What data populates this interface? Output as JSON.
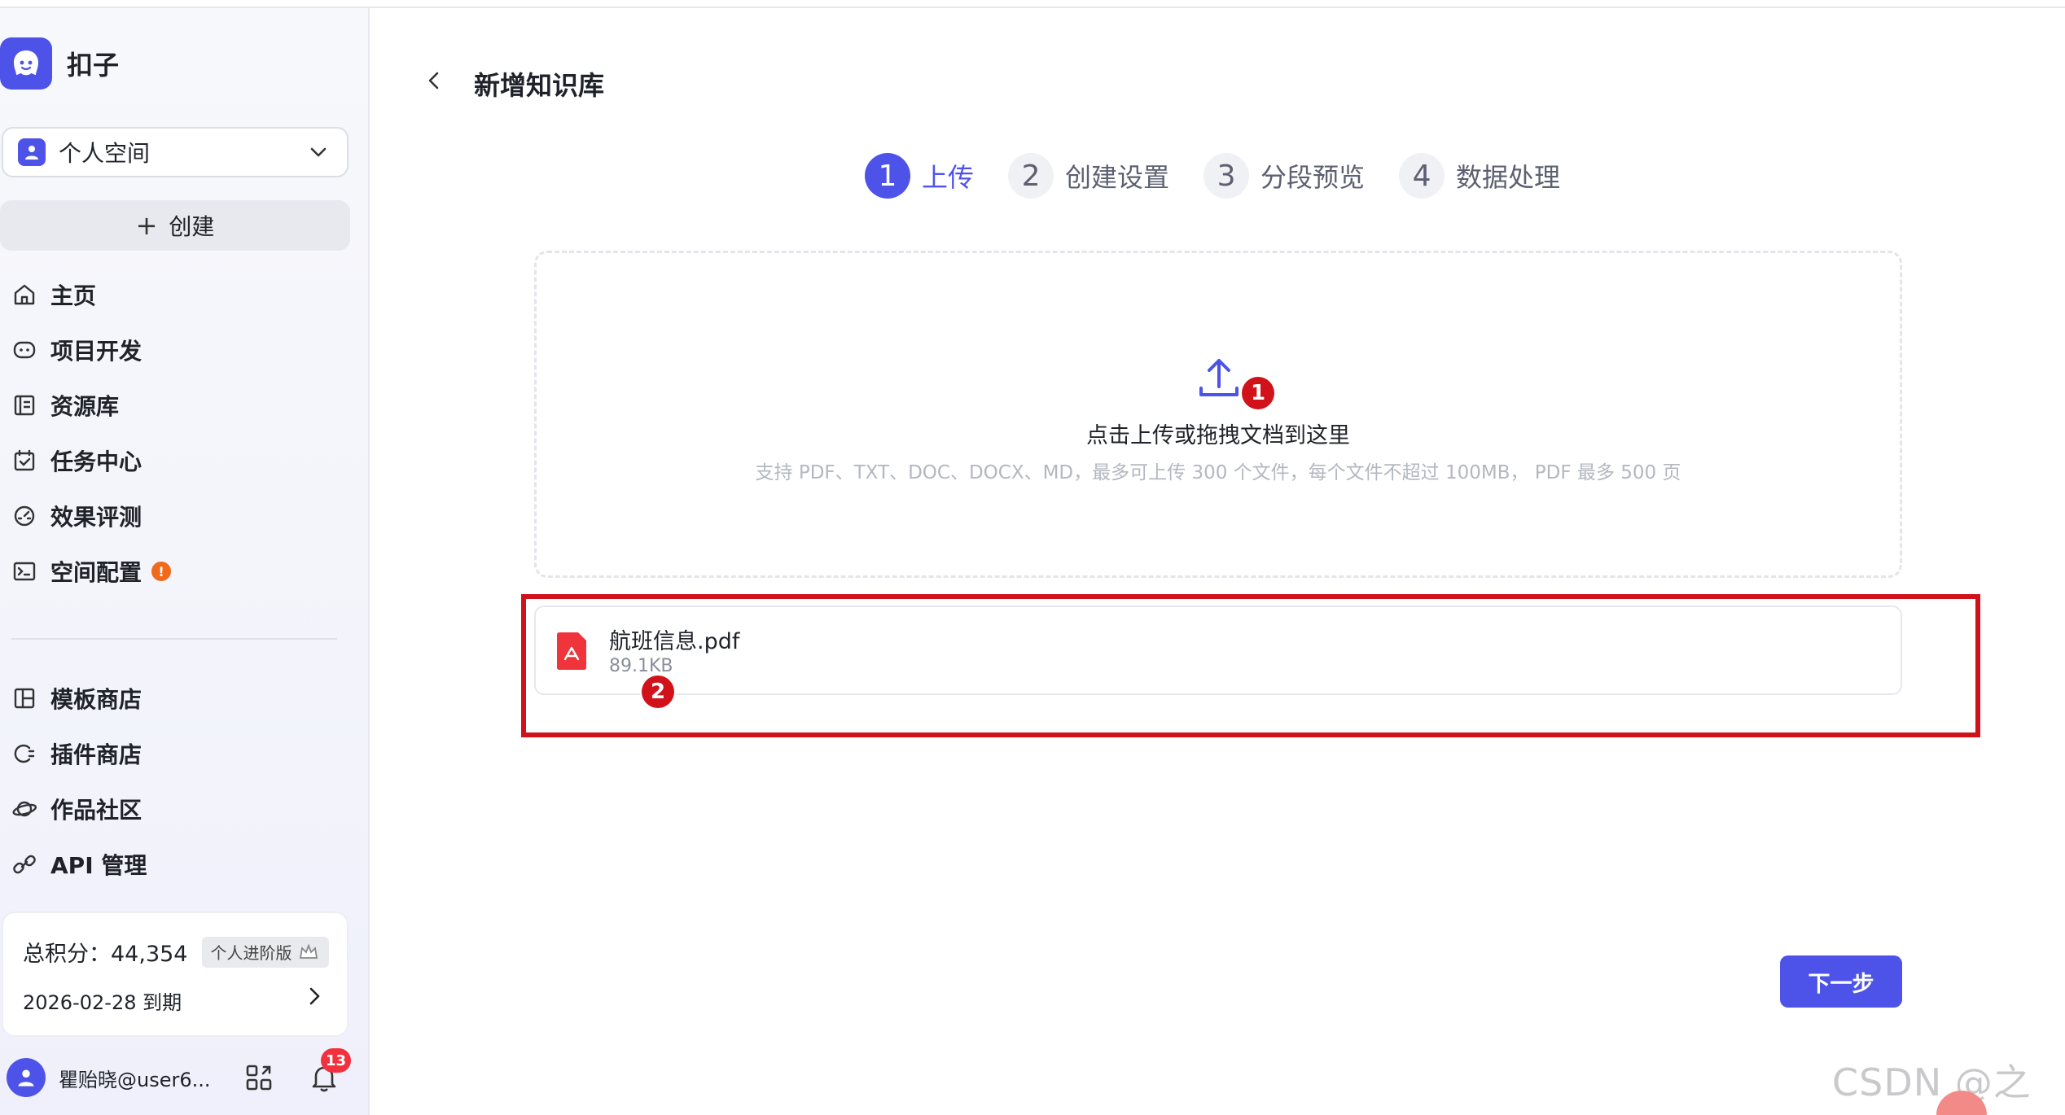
{
  "app": {
    "name": "扣子",
    "brand_color": "#4d53e8"
  },
  "sidebar": {
    "space": {
      "label": "个人空间"
    },
    "create_label": "创建",
    "items": [
      {
        "label": "主页",
        "icon": "home-icon"
      },
      {
        "label": "项目开发",
        "icon": "project-icon"
      },
      {
        "label": "资源库",
        "icon": "library-icon"
      },
      {
        "label": "任务中心",
        "icon": "task-icon"
      },
      {
        "label": "效果评测",
        "icon": "gauge-icon"
      },
      {
        "label": "空间配置",
        "icon": "terminal-icon",
        "badge": "!"
      }
    ],
    "items2": [
      {
        "label": "模板商店",
        "icon": "template-icon"
      },
      {
        "label": "插件商店",
        "icon": "plugin-icon"
      },
      {
        "label": "作品社区",
        "icon": "planet-icon"
      },
      {
        "label": "API 管理",
        "icon": "link-icon"
      }
    ],
    "points": {
      "label": "总积分：44,354",
      "plan": "个人进阶版",
      "expiry": "2026-02-28 到期"
    },
    "user": {
      "name": "瞿贻晓@user6...",
      "notifications": "13"
    }
  },
  "page": {
    "title": "新增知识库",
    "steps": [
      {
        "num": "1",
        "label": "上传",
        "active": true
      },
      {
        "num": "2",
        "label": "创建设置",
        "active": false
      },
      {
        "num": "3",
        "label": "分段预览",
        "active": false
      },
      {
        "num": "4",
        "label": "数据处理",
        "active": false
      }
    ],
    "dropzone": {
      "title": "点击上传或拖拽文档到这里",
      "hint": "支持 PDF、TXT、DOC、DOCX、MD，最多可上传 300 个文件，每个文件不超过 100MB， PDF 最多 500 页"
    },
    "file": {
      "name": "航班信息.pdf",
      "size": "89.1KB"
    },
    "next_label": "下一步",
    "markers": [
      "1",
      "2"
    ]
  },
  "watermark": "CSDN @之歆"
}
